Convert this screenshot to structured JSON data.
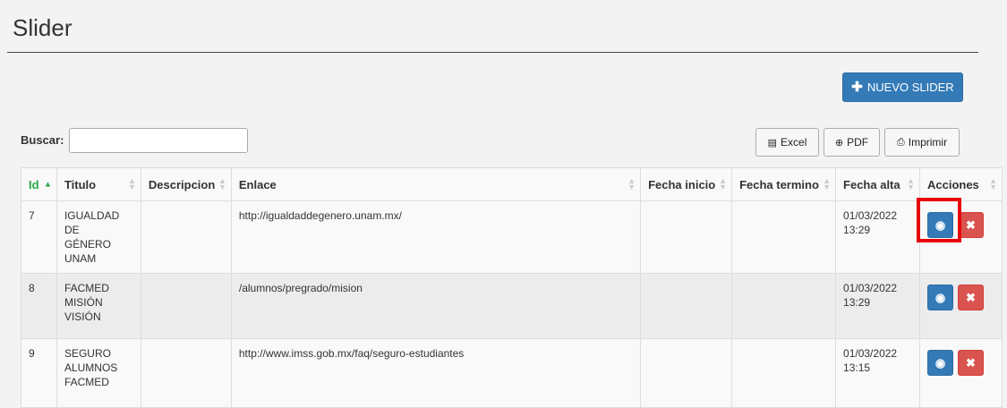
{
  "page": {
    "title": "Slider"
  },
  "toolbar": {
    "new_label": "NUEVO SLIDER"
  },
  "search": {
    "label": "Buscar:",
    "value": "",
    "placeholder": ""
  },
  "export": {
    "excel": "Excel",
    "pdf": "PDF",
    "print": "Imprimir"
  },
  "table": {
    "headers": {
      "id": "Id",
      "titulo": "Titulo",
      "descripcion": "Descripcion",
      "enlace": "Enlace",
      "fecha_inicio": "Fecha inicio",
      "fecha_termino": "Fecha termino",
      "fecha_alta": "Fecha alta",
      "acciones": "Acciones"
    },
    "rows": [
      {
        "id": "7",
        "titulo": [
          "IGUALDAD DE",
          "GÉNERO",
          "UNAM"
        ],
        "descripcion": "",
        "enlace": "http://igualdaddegenero.unam.mx/",
        "fecha_inicio": "",
        "fecha_termino": "",
        "fecha_alta": [
          "01/03/2022",
          "13:29"
        ]
      },
      {
        "id": "8",
        "titulo": [
          "FACMED",
          "MISIÓN",
          "VISIÓN"
        ],
        "descripcion": "",
        "enlace": "/alumnos/pregrado/mision",
        "fecha_inicio": "",
        "fecha_termino": "",
        "fecha_alta": [
          "01/03/2022",
          "13:29"
        ]
      },
      {
        "id": "9",
        "titulo": [
          "SEGURO",
          "ALUMNOS",
          "FACMED"
        ],
        "descripcion": "",
        "enlace": "http://www.imss.gob.mx/faq/seguro-estudiantes",
        "fecha_inicio": "",
        "fecha_termino": "",
        "fecha_alta": [
          "01/03/2022",
          "13:15"
        ]
      }
    ]
  },
  "icons": {
    "view": "eye-icon",
    "delete": "close-icon",
    "add": "plus-icon"
  },
  "colors": {
    "primary": "#337ab7",
    "danger": "#d9534f",
    "highlight": "#e8000d",
    "sort_active": "#28a745"
  }
}
